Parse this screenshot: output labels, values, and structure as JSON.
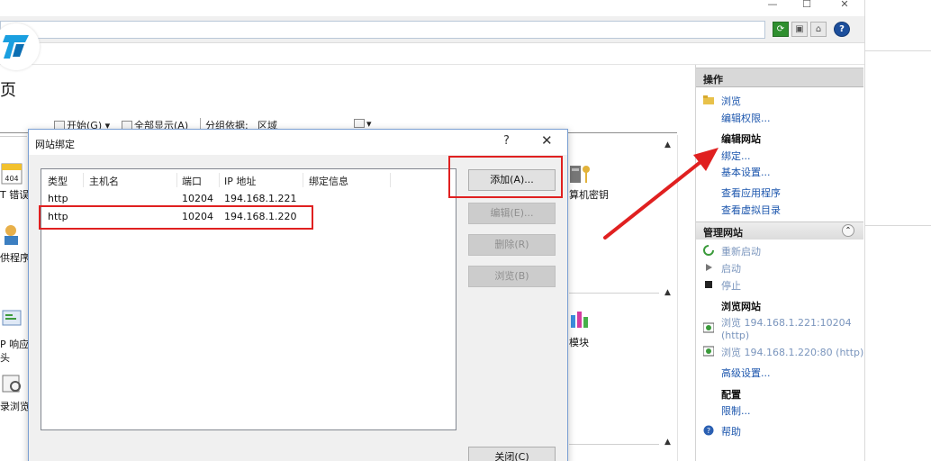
{
  "window": {
    "minimize": "—",
    "maximize": "☐",
    "close": "✕"
  },
  "toolbar_icons": {
    "refresh": "⟳",
    "stop": "▣",
    "home": "⌂",
    "help": "?"
  },
  "page": {
    "heading": "页"
  },
  "content_toolbar": {
    "start_label": "开始(G)",
    "show_all_label": "全部显示(A)",
    "group_by_label": "分组依据:",
    "group_by_value": "区域"
  },
  "background_features": {
    "f1_label": "T 错误",
    "f2_label": "供程序",
    "f3_label": "P 响应\n头",
    "f4_label": "录浏览",
    "f5_label": "算机密钥",
    "f6_label": "模块",
    "badge_404": "404"
  },
  "dialog": {
    "title": "网站绑定",
    "help_glyph": "?",
    "close_glyph": "✕",
    "columns": [
      "类型",
      "主机名",
      "端口",
      "IP 地址",
      "绑定信息"
    ],
    "rows": [
      {
        "type": "http",
        "host": "",
        "port": "10204",
        "ip": "194.168.1.221",
        "info": ""
      },
      {
        "type": "http",
        "host": "",
        "port": "10204",
        "ip": "194.168.1.220",
        "info": ""
      }
    ],
    "buttons": {
      "add": "添加(A)...",
      "edit": "编辑(E)...",
      "remove": "删除(R)",
      "browse": "浏览(B)",
      "close": "关闭(C)"
    }
  },
  "actions": {
    "header": "操作",
    "browse": "浏览",
    "edit_permissions": "编辑权限...",
    "edit_site_title": "编辑网站",
    "bindings": "绑定...",
    "basic_settings": "基本设置...",
    "view_applications": "查看应用程序",
    "view_virtual_dirs": "查看虚拟目录",
    "manage_site_title": "管理网站",
    "restart": "重新启动",
    "start": "启动",
    "stop": "停止",
    "browse_site_title": "浏览网站",
    "browse_221_line1": "浏览 194.168.1.221:10204",
    "browse_221_line2": "(http)",
    "browse_220": "浏览 194.168.1.220:80 (http)",
    "advanced_settings": "高级设置...",
    "config_title": "配置",
    "limits": "限制...",
    "help": "帮助",
    "collapse_glyph": "⌃"
  },
  "colors": {
    "annotation_red": "#e02020",
    "link_blue": "#1c56ad",
    "logo_blue": "#1a9fe0"
  }
}
